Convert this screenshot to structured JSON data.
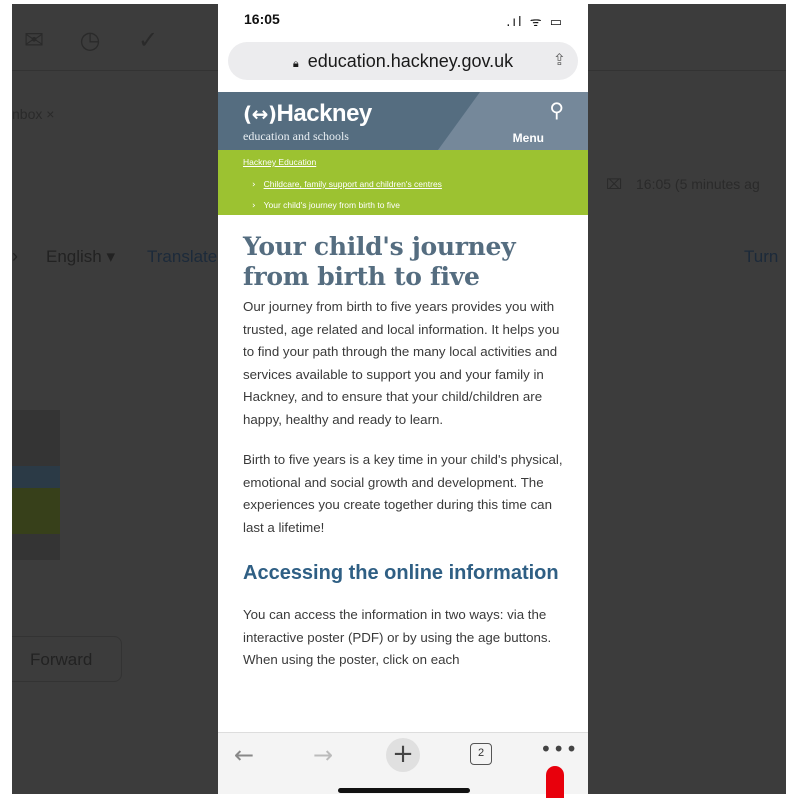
{
  "background": {
    "filter_chip": "nbox ×",
    "timestamp": "16:05 (5 minutes ag",
    "language": "English ▾",
    "translate": "Translate",
    "turn": "Turn",
    "forward": "Forward"
  },
  "status_bar": {
    "time": "16:05",
    "icons": ".ıl ᯤ ▭"
  },
  "browser": {
    "url": "education.hackney.gov.uk",
    "tab_count": "2"
  },
  "site_header": {
    "logo": "Hackney",
    "tagline": "education and schools",
    "menu": "Menu"
  },
  "breadcrumbs": [
    "Hackney Education",
    "Childcare, family support and children's centres",
    "Your child's journey from birth to five"
  ],
  "article": {
    "title": "Your child's journey from birth to five",
    "para1": "Our journey from birth to five years provides you with trusted, age related and local information. It helps you to find your path through the many local activities and services available to support you and your family in Hackney, and to ensure that your child/children are happy, healthy and ready to learn.",
    "para2": "Birth to five years is a key time in your child's physical, emotional and social growth and development. The experiences you create together during this time can last a lifetime!",
    "subheading": "Accessing the online information",
    "para3": "You can access the information in two ways: via the interactive poster (PDF) or by using the age buttons. When using the poster, click on each"
  },
  "colors": {
    "header": "#556d80",
    "breadcrumb_bg": "#9cc231",
    "title": "#556d80",
    "subheading": "#2f5f84",
    "marker": "#e8000c"
  }
}
